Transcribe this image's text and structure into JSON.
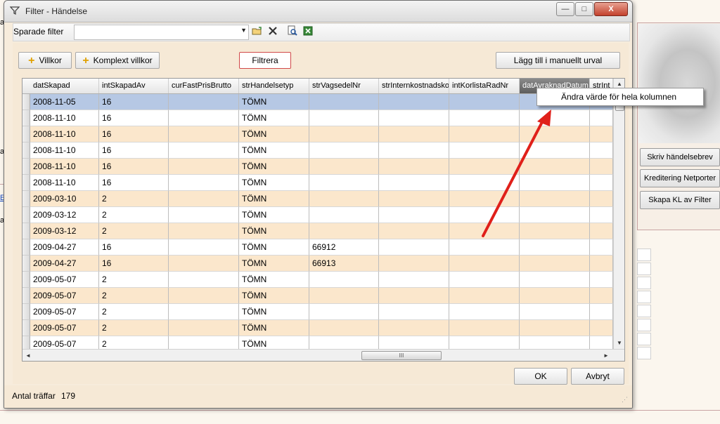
{
  "background_app": {
    "buttons": [
      "Skriv händelsebrev",
      "Kreditering Netporter",
      "Skapa KL av Filter"
    ],
    "left_fragments": [
      "a",
      "a",
      "E",
      "a"
    ]
  },
  "dialog": {
    "title": "Filter - Händelse",
    "window_buttons": {
      "minimize": "—",
      "maximize": "□",
      "close": "X"
    }
  },
  "saved_filters": {
    "label": "Sparade filter",
    "value": ""
  },
  "buttons": {
    "villkor": "Villkor",
    "komplext_villkor": "Komplext villkor",
    "filtrera": "Filtrera",
    "lagg_till": "Lägg till i manuellt urval",
    "ok": "OK",
    "avbryt": "Avbryt"
  },
  "grid": {
    "columns": [
      "datSkapad",
      "intSkapadAv",
      "curFastPrisBrutto",
      "strHandelsetyp",
      "strVagsedelNr",
      "strInternkostnadsko",
      "intKorlistaRadNr",
      "datAvraknadDatum",
      "strInt"
    ],
    "rows": [
      [
        "2008-11-05",
        "16",
        "",
        "TÖMN",
        "",
        "",
        "",
        "",
        ""
      ],
      [
        "2008-11-10",
        "16",
        "",
        "TÖMN",
        "",
        "",
        "",
        "",
        ""
      ],
      [
        "2008-11-10",
        "16",
        "",
        "TÖMN",
        "",
        "",
        "",
        "",
        ""
      ],
      [
        "2008-11-10",
        "16",
        "",
        "TÖMN",
        "",
        "",
        "",
        "",
        ""
      ],
      [
        "2008-11-10",
        "16",
        "",
        "TÖMN",
        "",
        "",
        "",
        "",
        ""
      ],
      [
        "2008-11-10",
        "16",
        "",
        "TÖMN",
        "",
        "",
        "",
        "",
        ""
      ],
      [
        "2009-03-10",
        "2",
        "",
        "TÖMN",
        "",
        "",
        "",
        "",
        ""
      ],
      [
        "2009-03-12",
        "2",
        "",
        "TÖMN",
        "",
        "",
        "",
        "",
        ""
      ],
      [
        "2009-03-12",
        "2",
        "",
        "TÖMN",
        "",
        "",
        "",
        "",
        ""
      ],
      [
        "2009-04-27",
        "16",
        "",
        "TÖMN",
        "66912",
        "",
        "",
        "",
        ""
      ],
      [
        "2009-04-27",
        "16",
        "",
        "TÖMN",
        "66913",
        "",
        "",
        "",
        ""
      ],
      [
        "2009-05-07",
        "2",
        "",
        "TÖMN",
        "",
        "",
        "",
        "",
        ""
      ],
      [
        "2009-05-07",
        "2",
        "",
        "TÖMN",
        "",
        "",
        "",
        "",
        ""
      ],
      [
        "2009-05-07",
        "2",
        "",
        "TÖMN",
        "",
        "",
        "",
        "",
        ""
      ],
      [
        "2009-05-07",
        "2",
        "",
        "TÖMN",
        "",
        "",
        "",
        "",
        ""
      ],
      [
        "2009-05-07",
        "2",
        "",
        "TÖMN",
        "",
        "",
        "",
        "",
        ""
      ]
    ],
    "hscroll_grip": "III"
  },
  "context_menu": {
    "item": "Ändra värde för hela kolumnen"
  },
  "status": {
    "label": "Antal träffar",
    "count": "179"
  },
  "icons": [
    "filter-icon",
    "open-folder-icon",
    "delete-x-icon",
    "preview-icon",
    "excel-export-icon",
    "plus-icon",
    "chevron-down-icon",
    "resize-grip-icon"
  ],
  "colors": {
    "row_odd": "#fbe7cc",
    "row_selected": "#b6c8e4",
    "annotation_arrow": "#e0201a",
    "dialog_bg": "#f7ecdc"
  }
}
